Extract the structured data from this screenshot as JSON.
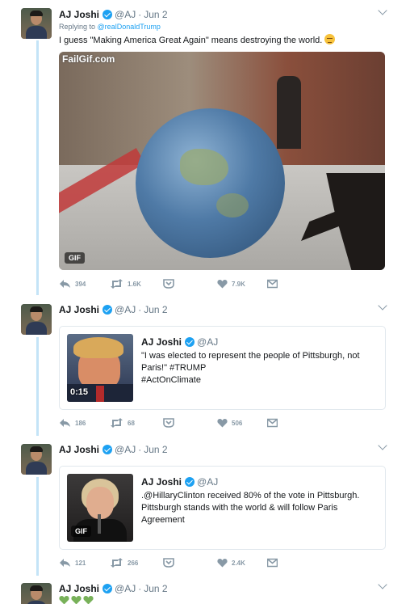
{
  "colors": {
    "accent": "#1da1f2",
    "muted": "#8899a6",
    "thread": "#c4e4f7",
    "heart_green": "#78b159"
  },
  "tweets": [
    {
      "name": "AJ Joshi",
      "handle": "@AJ",
      "separator": "·",
      "date": "Jun 2",
      "reply_prefix": "Replying to",
      "reply_to": "@realDonaldTrump",
      "text": "I guess \"Making America Great Again\" means destroying the world.",
      "emoji": "relieved-face-emoji",
      "media": {
        "watermark": "FailGif.com",
        "badge": "GIF"
      },
      "actions": {
        "replies": "394",
        "retweets": "1.6K",
        "likes": "7.9K"
      }
    },
    {
      "name": "AJ Joshi",
      "handle": "@AJ",
      "separator": "·",
      "date": "Jun 2",
      "quote": {
        "name": "AJ Joshi",
        "handle": "@AJ",
        "lines": [
          "\"I was elected to represent the people of Pittsburgh, not",
          "Paris!\" #TRUMP",
          "#ActOnClimate"
        ],
        "duration": "0:15"
      },
      "actions": {
        "replies": "186",
        "retweets": "68",
        "likes": "506"
      }
    },
    {
      "name": "AJ Joshi",
      "handle": "@AJ",
      "separator": "·",
      "date": "Jun 2",
      "quote": {
        "name": "AJ Joshi",
        "handle": "@AJ",
        "lines": [
          ".@HillaryClinton received 80% of the vote in Pittsburgh.",
          "Pittsburgh stands with the world & will follow Paris",
          "Agreement"
        ],
        "badge": "GIF"
      },
      "actions": {
        "replies": "121",
        "retweets": "266",
        "likes": "2.4K"
      }
    },
    {
      "name": "AJ Joshi",
      "handle": "@AJ",
      "separator": "·",
      "date": "Jun 2",
      "emoji": [
        "green-heart-emoji",
        "green-heart-emoji",
        "green-heart-emoji"
      ]
    }
  ]
}
